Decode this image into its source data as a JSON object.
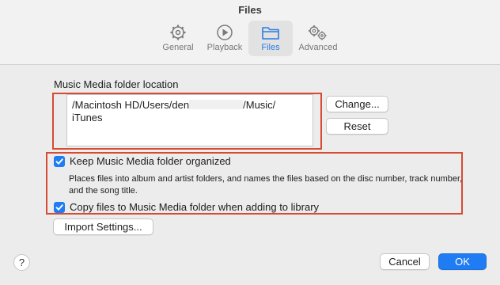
{
  "window": {
    "title": "Files"
  },
  "tabs": [
    {
      "label": "General",
      "icon": "gear-icon"
    },
    {
      "label": "Playback",
      "icon": "play-circle-icon"
    },
    {
      "label": "Files",
      "icon": "folder-icon",
      "active": true
    },
    {
      "label": "Advanced",
      "icon": "gears-icon"
    }
  ],
  "media_location": {
    "label": "Music Media folder location",
    "path_part1": "/Macintosh HD/Users/den",
    "path_part2": "/Music/",
    "path_part3": "iTunes"
  },
  "buttons": {
    "change": "Change...",
    "reset": "Reset",
    "import_settings": "Import Settings...",
    "cancel": "Cancel",
    "ok": "OK",
    "help": "?"
  },
  "options": {
    "keep_organized": {
      "label": "Keep Music Media folder organized",
      "checked": true
    },
    "keep_organized_desc": "Places files into album and artist folders, and names the files based on the disc number, track number, and the song title.",
    "copy_files": {
      "label": "Copy files to Music Media folder when adding to library",
      "checked": true
    }
  },
  "colors": {
    "accent": "#1f7cf2",
    "highlight_box": "#d64b32"
  }
}
